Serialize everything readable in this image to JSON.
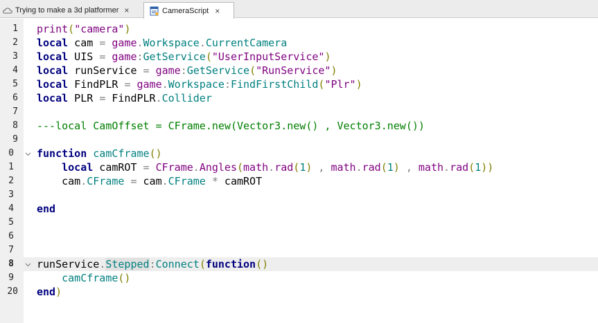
{
  "tabs": [
    {
      "label": "Trying to make a 3d platformer",
      "close": "×",
      "active": false
    },
    {
      "label": "CameraScript",
      "close": "×",
      "active": true
    }
  ],
  "gutter": {
    "line_numbers": [
      "1",
      "2",
      "3",
      "4",
      "5",
      "6",
      "7",
      "8",
      "9",
      "0",
      "1",
      "2",
      "3",
      "4",
      "5",
      "6",
      "7",
      "8",
      "9",
      "20"
    ]
  },
  "code": {
    "l1": [
      "print",
      "(",
      "\"camera\"",
      ")"
    ],
    "l2": [
      "local",
      " cam ",
      "=",
      " game",
      ".",
      "Workspace",
      ".",
      "CurrentCamera"
    ],
    "l3": [
      "local",
      " UIS ",
      "=",
      " game",
      ":",
      "GetService",
      "(",
      "\"UserInputService\"",
      ")"
    ],
    "l4": [
      "local",
      " runService ",
      "=",
      " game",
      ":",
      "GetService",
      "(",
      "\"RunService\"",
      ")"
    ],
    "l5": [
      "local",
      " FindPLR ",
      "=",
      " game",
      ".",
      "Workspace",
      ":",
      "FindFirstChild",
      "(",
      "\"Plr\"",
      ")"
    ],
    "l6": [
      "local",
      " PLR ",
      "=",
      " FindPLR",
      ".",
      "Collider"
    ],
    "l8": [
      "---local CamOffset = CFrame.new(Vector3.new() , Vector3.new())"
    ],
    "l10": [
      "function",
      " ",
      "camCframe",
      "()"
    ],
    "l11": [
      "    ",
      "local",
      " camROT ",
      "=",
      " CFrame",
      ".",
      "Angles",
      "(",
      "math",
      ".",
      "rad",
      "(",
      "1",
      ")",
      " , ",
      "math",
      ".",
      "rad",
      "(",
      "1",
      ")",
      " , ",
      "math",
      ".",
      "rad",
      "(",
      "1",
      "))"
    ],
    "l12": [
      "    ",
      "cam",
      ".",
      "CFrame",
      " ",
      "=",
      " cam",
      ".",
      "CFrame",
      " ",
      "*",
      " camROT"
    ],
    "l14": [
      "end"
    ],
    "l18": [
      "runService",
      ".",
      "Stepped",
      ":",
      "Connect",
      "(",
      "function",
      "()"
    ],
    "l19": [
      "    ",
      "camCframe",
      "()"
    ],
    "l20": [
      "end",
      ")"
    ]
  },
  "colors": {
    "keyword": "#00007f",
    "string": "#7f007f",
    "member": "#007f7f",
    "comment": "#007f00",
    "gutter": "#f0f0f0",
    "current_line": "#eeeeee"
  }
}
